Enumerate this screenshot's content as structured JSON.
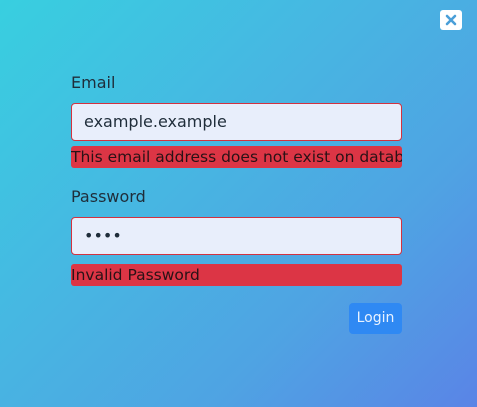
{
  "modal": {
    "close_icon": "close-icon"
  },
  "form": {
    "email_label": "Email",
    "email_value": "example.example",
    "email_error": "This email address does not exist on database",
    "password_label": "Password",
    "password_value": "••••",
    "password_error": "Invalid Password",
    "login_label": "Login"
  },
  "colors": {
    "gradient_start": "#38cfe0",
    "gradient_end": "#5a84e6",
    "error_bg": "#dc3545",
    "button_bg": "#2f89f3",
    "input_bg": "#e8eefb",
    "input_border": "#d2323f"
  }
}
